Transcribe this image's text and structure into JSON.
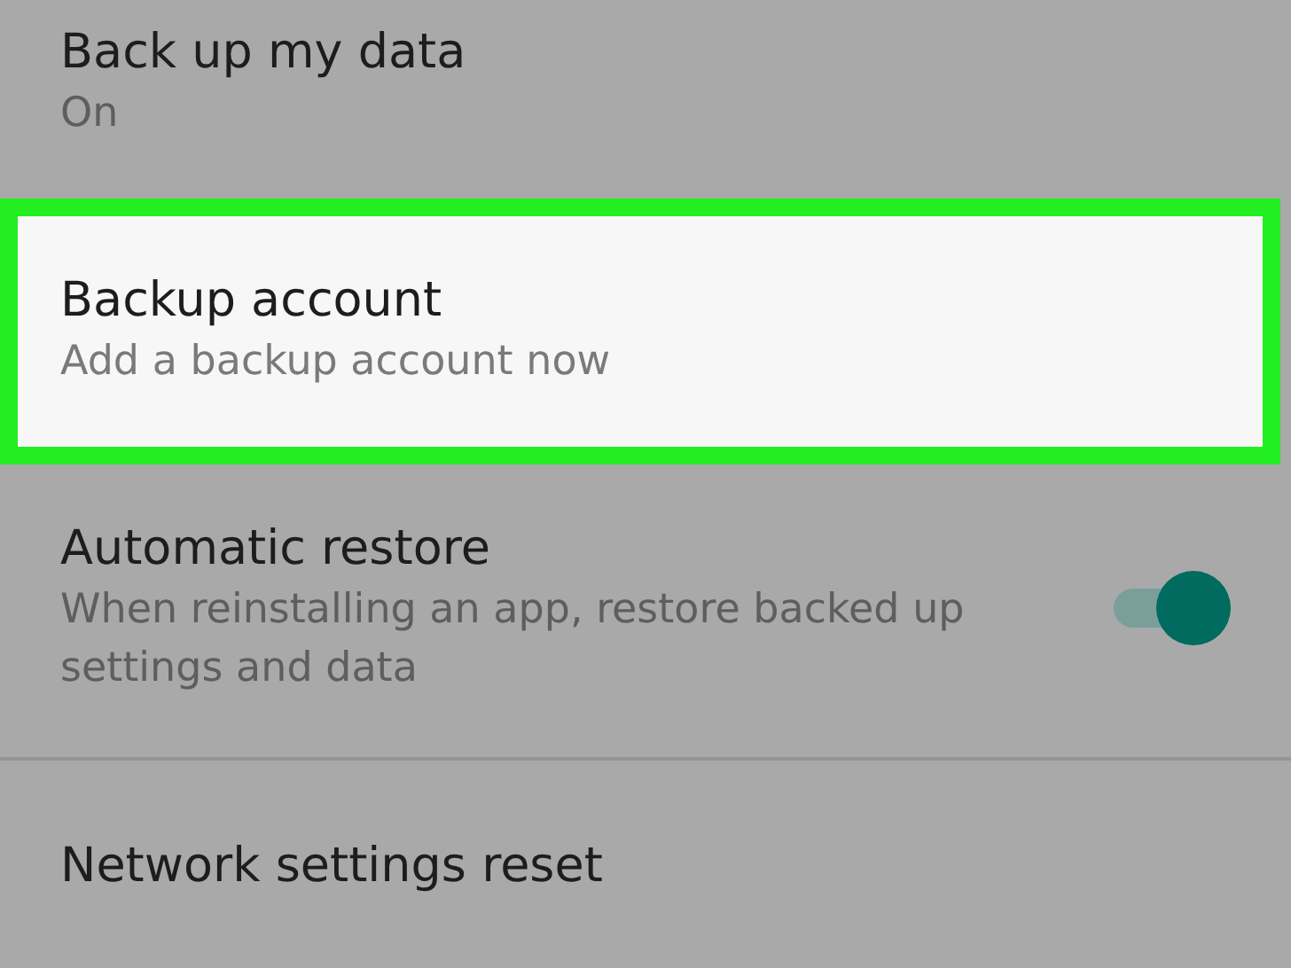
{
  "settings": [
    {
      "kind": "text",
      "title": "Back up my data",
      "subtitle": "On",
      "highlighted": false
    },
    {
      "kind": "text",
      "title": "Backup account",
      "subtitle": "Add a backup account now",
      "highlighted": true
    },
    {
      "kind": "toggle",
      "title": "Automatic restore",
      "subtitle": "When reinstalling an app, restore backed up settings and data",
      "highlighted": false,
      "on": true
    },
    {
      "kind": "text",
      "title": "Network settings reset",
      "highlighted": false
    }
  ]
}
